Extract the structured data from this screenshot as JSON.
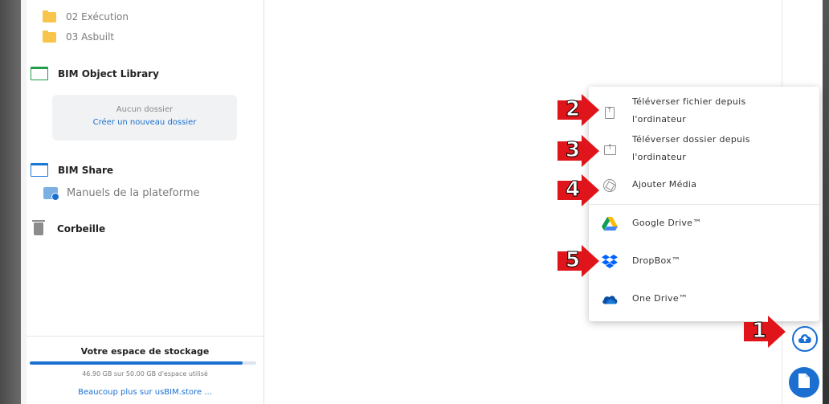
{
  "sidebar": {
    "tree": [
      {
        "label": "02 Exécution"
      },
      {
        "label": "03 Asbuilt"
      }
    ],
    "sections": {
      "bim_object_library": "BIM Object Library",
      "bim_share": "BIM Share",
      "corbeille": "Corbeille"
    },
    "empty_box": {
      "title": "Aucun dossier",
      "link": "Créer un nouveau dossier"
    },
    "shared_folder": "Manuels de la plateforme"
  },
  "storage": {
    "title": "Votre espace de stockage",
    "used_text": "46.90 GB sur 50.00 GB d'espace utilisé",
    "used_fraction": 0.938,
    "link": "Beaucoup plus sur usBIM.store ..."
  },
  "menu": {
    "items": [
      {
        "label_line1": "Téléverser fichier depuis",
        "label_line2": "l'ordinateur",
        "icon": "file-upload-icon"
      },
      {
        "label_line1": "Téléverser dossier depuis",
        "label_line2": "l'ordinateur",
        "icon": "folder-upload-icon"
      },
      {
        "label": "Ajouter Média",
        "icon": "aperture-icon"
      },
      {
        "label": "Google Drive™",
        "icon": "google-drive-icon"
      },
      {
        "label": "DropBox™",
        "icon": "dropbox-icon"
      },
      {
        "label": "One Drive™",
        "icon": "onedrive-icon"
      }
    ]
  },
  "annotations": [
    "1",
    "2",
    "3",
    "4",
    "5"
  ],
  "colors": {
    "accent": "#1a6fd1",
    "annotation_red": "#e0151b",
    "folder_yellow": "#f7c54a",
    "folder_green": "#1e9e4a"
  }
}
